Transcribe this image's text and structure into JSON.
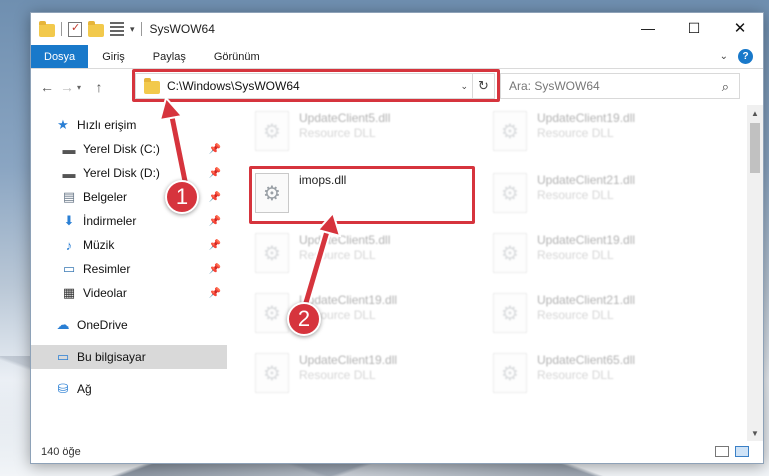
{
  "window": {
    "title": "SysWOW64"
  },
  "ribbon": {
    "tabs": [
      "Dosya",
      "Giriş",
      "Paylaş",
      "Görünüm"
    ]
  },
  "address": {
    "path": "C:\\Windows\\SysWOW64"
  },
  "search": {
    "placeholder": "Ara: SysWOW64"
  },
  "sidebar": {
    "quick_access": "Hızlı erişim",
    "items": [
      {
        "label": "Yerel Disk (C:)",
        "icon": "drive-icon"
      },
      {
        "label": "Yerel Disk (D:)",
        "icon": "drive-icon"
      },
      {
        "label": "Belgeler",
        "icon": "documents-icon"
      },
      {
        "label": "İndirmeler",
        "icon": "download-icon"
      },
      {
        "label": "Müzik",
        "icon": "music-icon"
      },
      {
        "label": "Resimler",
        "icon": "pictures-icon"
      },
      {
        "label": "Videolar",
        "icon": "videos-icon"
      }
    ],
    "onedrive": "OneDrive",
    "this_pc": "Bu bilgisayar",
    "network": "Ağ"
  },
  "files": [
    {
      "name": "UpdateClient5.dll",
      "type": "Resource DLL",
      "blurred": true
    },
    {
      "name": "UpdateClient19.dll",
      "type": "Resource DLL",
      "blurred": true
    },
    {
      "name": "imops.dll",
      "type": "",
      "blurred": false
    },
    {
      "name": "UpdateClient21.dll",
      "type": "Resource DLL",
      "blurred": true
    },
    {
      "name": "UpdateClient5.dll",
      "type": "Resource DLL",
      "blurred": true
    },
    {
      "name": "UpdateClient19.dll",
      "type": "Resource DLL",
      "blurred": true
    },
    {
      "name": "UpdateClient19.dll",
      "type": "Resource DLL",
      "blurred": true
    },
    {
      "name": "UpdateClient21.dll",
      "type": "Resource DLL",
      "blurred": true
    },
    {
      "name": "UpdateClient19.dll",
      "type": "Resource DLL",
      "blurred": true
    },
    {
      "name": "UpdateClient65.dll",
      "type": "Resource DLL",
      "blurred": true
    }
  ],
  "status": {
    "count": "140 öğe"
  },
  "annotations": {
    "step1": "1",
    "step2": "2",
    "color": "#d6343d"
  }
}
